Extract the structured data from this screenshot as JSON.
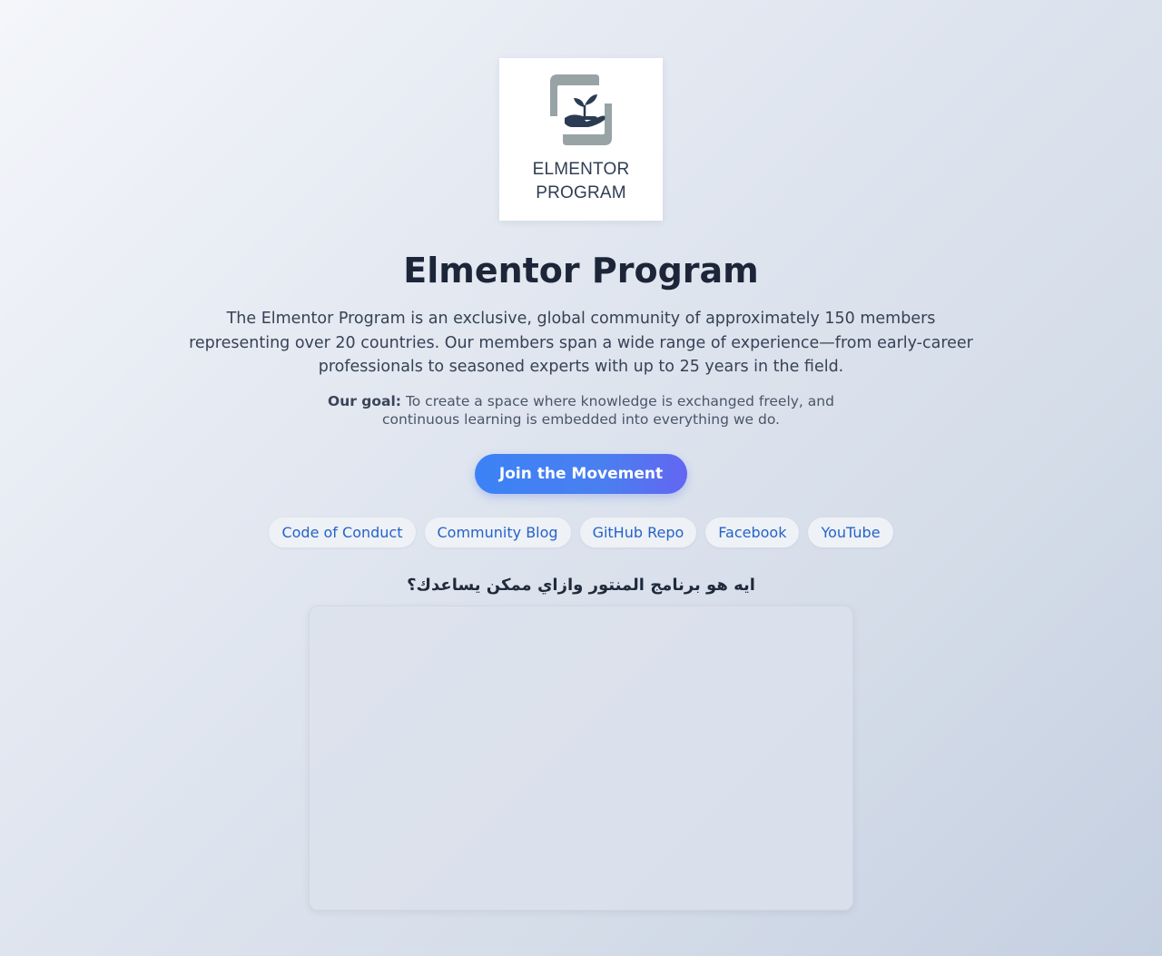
{
  "logo": {
    "line1": "ELMENTOR",
    "line2": "PROGRAM",
    "colors": {
      "frame": "#98a3a6",
      "hand": "#2a3b52",
      "text": "#2f3e53"
    },
    "icon": "hand-with-sprout-icon"
  },
  "header": {
    "title": "Elmentor Program"
  },
  "intro": {
    "text": "The Elmentor Program is an exclusive, global community of approximately 150 members representing over 20 countries. Our members span a wide range of experience—from early-career professionals to seasoned experts with up to 25 years in the field."
  },
  "goal": {
    "label": "Our goal:",
    "text": "To create a space where knowledge is exchanged freely, and continuous learning is embedded into everything we do."
  },
  "cta": {
    "label": "Join the Movement",
    "colors": {
      "start": "#3b82f6",
      "end": "#6366f1"
    }
  },
  "links": [
    {
      "label": "Code of Conduct"
    },
    {
      "label": "Community Blog"
    },
    {
      "label": "GitHub Repo"
    },
    {
      "label": "Facebook"
    },
    {
      "label": "YouTube"
    }
  ],
  "video_section": {
    "heading": "ايه هو برنامج المنتور وازاي ممكن يساعدك؟"
  }
}
